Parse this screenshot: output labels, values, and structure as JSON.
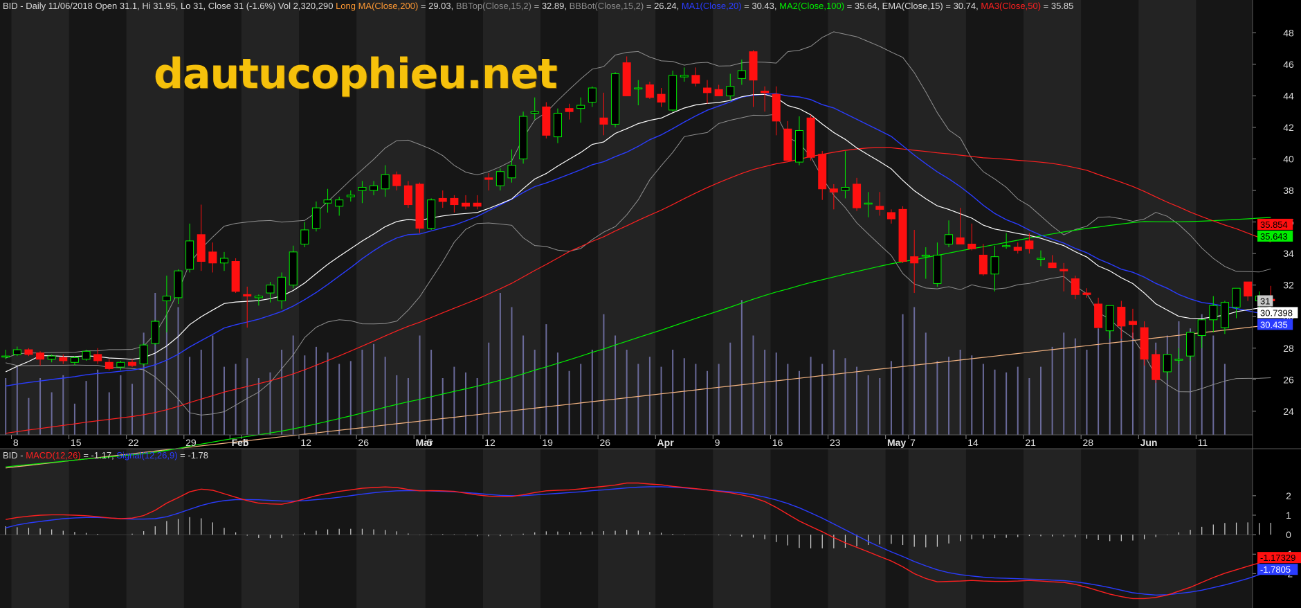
{
  "header_price": [
    {
      "text": "BID - Daily 11/06/2018 Open 31.1, Hi 31.95, Lo 31, Close 31 (-1.6%) Vol 2,320,290 ",
      "color": "#d8d8d8"
    },
    {
      "text": "Long MA(Close,200)",
      "color": "#ff9933"
    },
    {
      "text": " = 29.03, ",
      "color": "#d8d8d8"
    },
    {
      "text": "BBTop(Close,15,2)",
      "color": "#8c8c8c"
    },
    {
      "text": " = 32.89, ",
      "color": "#d8d8d8"
    },
    {
      "text": "BBBot(Close,15,2)",
      "color": "#8c8c8c"
    },
    {
      "text": " = 26.24, ",
      "color": "#d8d8d8"
    },
    {
      "text": "MA1(Close,20)",
      "color": "#2a3cff"
    },
    {
      "text": " = 30.43, ",
      "color": "#d8d8d8"
    },
    {
      "text": "MA2(Close,100)",
      "color": "#00ee00"
    },
    {
      "text": " = 35.64, EMA(Close,15) = 30.74, ",
      "color": "#d8d8d8"
    },
    {
      "text": "MA3(Close,50)",
      "color": "#ff2020"
    },
    {
      "text": " = 35.85",
      "color": "#d8d8d8"
    }
  ],
  "header_macd": [
    {
      "text": "BID - ",
      "color": "#d8d8d8"
    },
    {
      "text": "MACD(12,26)",
      "color": "#ff2020"
    },
    {
      "text": " = -1.17, ",
      "color": "#d8d8d8"
    },
    {
      "text": "Signal(12,26,9)",
      "color": "#2a3cff"
    },
    {
      "text": " = -1.78",
      "color": "#d8d8d8"
    }
  ],
  "watermark": "dautucophieu.net",
  "chart_data": [
    {
      "type": "candlestick",
      "ticker": "BID",
      "ylim": [
        22.5,
        49.2
      ],
      "yticks": [
        24,
        26,
        28,
        30,
        32,
        34,
        36,
        38,
        40,
        42,
        44,
        46,
        48
      ],
      "x_labels": [
        {
          "label": "8",
          "i": 1
        },
        {
          "label": "15",
          "i": 6
        },
        {
          "label": "22",
          "i": 11
        },
        {
          "label": "29",
          "i": 16
        },
        {
          "label": "Feb",
          "i": 20,
          "bold": true
        },
        {
          "label": "5",
          "i": 21
        },
        {
          "label": "12",
          "i": 26
        },
        {
          "label": "26",
          "i": 31
        },
        {
          "label": "Mar",
          "i": 36,
          "bold": true
        },
        {
          "label": "5",
          "i": 37
        },
        {
          "label": "12",
          "i": 42
        },
        {
          "label": "19",
          "i": 47
        },
        {
          "label": "26",
          "i": 52
        },
        {
          "label": "Apr",
          "i": 57,
          "bold": true
        },
        {
          "label": "9",
          "i": 62
        },
        {
          "label": "16",
          "i": 67
        },
        {
          "label": "23",
          "i": 72
        },
        {
          "label": "May",
          "i": 77,
          "bold": true
        },
        {
          "label": "7",
          "i": 79
        },
        {
          "label": "14",
          "i": 84
        },
        {
          "label": "21",
          "i": 89
        },
        {
          "label": "28",
          "i": 94
        },
        {
          "label": "Jun",
          "i": 99,
          "bold": true
        },
        {
          "label": "11",
          "i": 104
        }
      ],
      "candles": [
        [
          27.5,
          27.9,
          27.3,
          27.5
        ],
        [
          27.6,
          28.1,
          27.5,
          27.9
        ],
        [
          27.9,
          28.0,
          27.5,
          27.6
        ],
        [
          27.7,
          27.8,
          26.9,
          27.3
        ],
        [
          27.3,
          27.6,
          27.1,
          27.5
        ],
        [
          27.4,
          27.6,
          27.0,
          27.2
        ],
        [
          27.1,
          27.5,
          26.9,
          27.4
        ],
        [
          27.3,
          27.9,
          27.2,
          27.8
        ],
        [
          27.6,
          28.0,
          27.0,
          27.2
        ],
        [
          27.1,
          27.3,
          26.6,
          26.7
        ],
        [
          26.8,
          27.2,
          26.6,
          27.1
        ],
        [
          27.1,
          27.3,
          26.8,
          26.9
        ],
        [
          27.0,
          28.3,
          26.9,
          28.2
        ],
        [
          28.3,
          29.8,
          28.2,
          29.7
        ],
        [
          31.0,
          32.6,
          29.0,
          31.3
        ],
        [
          31.2,
          33.0,
          30.8,
          32.9
        ],
        [
          33.0,
          35.9,
          32.8,
          34.8
        ],
        [
          35.2,
          37.1,
          32.9,
          33.5
        ],
        [
          34.1,
          34.7,
          32.8,
          33.4
        ],
        [
          33.4,
          34.1,
          32.9,
          33.7
        ],
        [
          33.5,
          33.7,
          31.5,
          31.6
        ],
        [
          31.4,
          31.9,
          29.3,
          31.3
        ],
        [
          31.2,
          31.4,
          30.7,
          31.3
        ],
        [
          31.5,
          32.2,
          30.9,
          32.0
        ],
        [
          31.0,
          32.8,
          30.5,
          32.5
        ],
        [
          32.0,
          34.5,
          31.8,
          34.1
        ],
        [
          34.6,
          36.0,
          34.4,
          35.5
        ],
        [
          35.6,
          37.3,
          35.4,
          36.9
        ],
        [
          37.2,
          38.1,
          36.6,
          37.4
        ],
        [
          37.0,
          37.6,
          36.4,
          37.4
        ],
        [
          37.6,
          38.0,
          37.3,
          37.7
        ],
        [
          38.0,
          38.6,
          37.2,
          38.2
        ],
        [
          38.0,
          38.6,
          37.7,
          38.3
        ],
        [
          38.1,
          39.6,
          37.6,
          39.0
        ],
        [
          39.0,
          39.2,
          38.0,
          38.3
        ],
        [
          38.3,
          38.6,
          36.9,
          37.1
        ],
        [
          38.4,
          38.5,
          35.3,
          35.6
        ],
        [
          35.6,
          37.5,
          35.5,
          37.4
        ],
        [
          37.5,
          38.0,
          36.9,
          37.3
        ],
        [
          37.5,
          37.7,
          36.6,
          37.1
        ],
        [
          37.2,
          37.7,
          36.8,
          37.0
        ],
        [
          37.2,
          37.7,
          36.8,
          37.0
        ],
        [
          38.8,
          39.1,
          38.0,
          38.7
        ],
        [
          38.3,
          39.4,
          38.0,
          39.2
        ],
        [
          38.8,
          40.6,
          38.5,
          39.6
        ],
        [
          40.0,
          43.0,
          39.7,
          42.7
        ],
        [
          42.9,
          43.9,
          42.5,
          43.0
        ],
        [
          43.3,
          43.6,
          41.3,
          41.5
        ],
        [
          41.4,
          43.2,
          41.0,
          42.9
        ],
        [
          43.2,
          43.5,
          42.5,
          43.0
        ],
        [
          43.2,
          43.9,
          42.3,
          43.4
        ],
        [
          43.6,
          44.6,
          43.3,
          44.5
        ],
        [
          42.6,
          44.2,
          41.5,
          42.2
        ],
        [
          42.2,
          45.5,
          42.0,
          45.4
        ],
        [
          46.1,
          46.5,
          44.0,
          44.0
        ],
        [
          44.5,
          45.0,
          43.4,
          44.5
        ],
        [
          44.7,
          44.9,
          43.8,
          43.9
        ],
        [
          44.1,
          44.5,
          43.3,
          43.6
        ],
        [
          43.1,
          45.6,
          43.0,
          45.3
        ],
        [
          45.2,
          45.8,
          44.9,
          45.3
        ],
        [
          45.3,
          45.8,
          44.6,
          44.8
        ],
        [
          44.5,
          45.0,
          43.5,
          44.2
        ],
        [
          44.4,
          44.7,
          44.0,
          44.0
        ],
        [
          44.0,
          45.4,
          43.7,
          44.6
        ],
        [
          45.1,
          46.3,
          44.7,
          45.6
        ],
        [
          46.8,
          46.9,
          43.3,
          45.0
        ],
        [
          44.3,
          44.6,
          43.0,
          44.2
        ],
        [
          44.1,
          44.6,
          41.5,
          42.4
        ],
        [
          41.9,
          42.4,
          40.0,
          39.9
        ],
        [
          39.8,
          42.7,
          39.6,
          41.8
        ],
        [
          42.6,
          42.8,
          39.9,
          40.1
        ],
        [
          40.3,
          40.5,
          37.4,
          38.1
        ],
        [
          38.1,
          38.4,
          36.8,
          37.9
        ],
        [
          38.0,
          40.5,
          37.5,
          38.2
        ],
        [
          38.4,
          38.8,
          36.7,
          36.9
        ],
        [
          37.2,
          37.9,
          36.3,
          37.2
        ],
        [
          37.0,
          37.9,
          36.4,
          36.8
        ],
        [
          36.6,
          36.8,
          35.9,
          36.2
        ],
        [
          36.8,
          37.0,
          33.4,
          33.5
        ],
        [
          33.8,
          35.5,
          31.5,
          33.4
        ],
        [
          33.9,
          34.4,
          32.4,
          33.9
        ],
        [
          32.1,
          34.7,
          31.9,
          33.9
        ],
        [
          34.6,
          36.1,
          34.4,
          35.2
        ],
        [
          35.0,
          36.9,
          34.8,
          34.6
        ],
        [
          34.6,
          35.9,
          34.2,
          34.3
        ],
        [
          33.9,
          34.6,
          32.6,
          32.7
        ],
        [
          32.7,
          34.5,
          31.6,
          33.8
        ],
        [
          34.5,
          35.3,
          34.3,
          34.5
        ],
        [
          34.4,
          34.7,
          34.0,
          34.2
        ],
        [
          34.8,
          35.3,
          34.0,
          34.3
        ],
        [
          33.7,
          34.2,
          33.2,
          33.7
        ],
        [
          33.4,
          33.9,
          33.2,
          33.1
        ],
        [
          33.0,
          33.4,
          31.6,
          32.9
        ],
        [
          32.4,
          32.6,
          31.1,
          31.4
        ],
        [
          31.5,
          31.8,
          31.2,
          31.4
        ],
        [
          30.8,
          31.2,
          29.3,
          29.3
        ],
        [
          29.1,
          30.5,
          28.6,
          30.7
        ],
        [
          30.6,
          31.0,
          28.6,
          29.4
        ],
        [
          29.7,
          30.5,
          28.6,
          29.5
        ],
        [
          29.3,
          29.7,
          26.9,
          27.3
        ],
        [
          27.6,
          27.9,
          25.8,
          26.0
        ],
        [
          26.5,
          27.6,
          26.0,
          27.6
        ],
        [
          27.3,
          28.0,
          27.0,
          27.3
        ],
        [
          27.5,
          29.0,
          27.2,
          29.0
        ],
        [
          28.8,
          29.6,
          28.0,
          29.8
        ],
        [
          29.8,
          31.3,
          29.0,
          30.7
        ],
        [
          29.3,
          31.0,
          28.9,
          30.9
        ],
        [
          30.6,
          31.7,
          29.9,
          31.8
        ],
        [
          32.2,
          32.2,
          31.0,
          31.3
        ],
        [
          31.0,
          31.6,
          30.5,
          31.3
        ],
        [
          31.1,
          31.95,
          31.0,
          31.0
        ]
      ],
      "volume": [
        40,
        48,
        26,
        40,
        30,
        42,
        22,
        38,
        46,
        30,
        42,
        36,
        72,
        100,
        85,
        90,
        55,
        60,
        70,
        48,
        50,
        54,
        40,
        44,
        60,
        70,
        56,
        62,
        58,
        50,
        52,
        60,
        64,
        55,
        42,
        40,
        70,
        60,
        40,
        48,
        44,
        40,
        65,
        100,
        90,
        70,
        60,
        78,
        58,
        45,
        50,
        60,
        85,
        70,
        60,
        50,
        55,
        48,
        60,
        54,
        50,
        45,
        50,
        65,
        95,
        70,
        60,
        58,
        50,
        45,
        55,
        50,
        60,
        54,
        48,
        42,
        40,
        52,
        85,
        90,
        72,
        52,
        55,
        60,
        56,
        50,
        46,
        44,
        48,
        40,
        48,
        62,
        72,
        68,
        60,
        75,
        90,
        85,
        72,
        60,
        65,
        70,
        80,
        75,
        85,
        70,
        50
      ],
      "volume_axis_max": 160,
      "macd": [
        0.78,
        0.88,
        0.95,
        1.0,
        1.02,
        1.02,
        1.0,
        0.97,
        0.92,
        0.86,
        0.82,
        0.85,
        0.98,
        1.25,
        1.62,
        1.9,
        2.2,
        2.34,
        2.28,
        2.1,
        1.92,
        1.75,
        1.62,
        1.58,
        1.56,
        1.68,
        1.84,
        2.0,
        2.12,
        2.22,
        2.3,
        2.38,
        2.42,
        2.45,
        2.42,
        2.32,
        2.25,
        2.26,
        2.25,
        2.22,
        2.13,
        2.04,
        1.98,
        1.95,
        1.96,
        2.05,
        2.16,
        2.25,
        2.28,
        2.3,
        2.35,
        2.42,
        2.48,
        2.55,
        2.65,
        2.65,
        2.6,
        2.56,
        2.48,
        2.42,
        2.36,
        2.3,
        2.22,
        2.15,
        2.04,
        1.9,
        1.7,
        1.4,
        1.05,
        0.7,
        0.42,
        0.15,
        -0.15,
        -0.42,
        -0.65,
        -0.88,
        -1.12,
        -1.35,
        -1.65,
        -2.0,
        -2.25,
        -2.42,
        -2.4,
        -2.38,
        -2.35,
        -2.38,
        -2.4,
        -2.4,
        -2.38,
        -2.35,
        -2.38,
        -2.42,
        -2.45,
        -2.55,
        -2.7,
        -2.88,
        -3.05,
        -3.18,
        -3.28,
        -3.28,
        -3.22,
        -3.1,
        -2.9,
        -2.7,
        -2.45,
        -2.2,
        -1.98,
        -1.8,
        -1.62,
        -1.45,
        -1.17
      ],
      "signal": [
        0.35,
        0.5,
        0.6,
        0.68,
        0.75,
        0.82,
        0.86,
        0.88,
        0.88,
        0.86,
        0.82,
        0.8,
        0.8,
        0.82,
        0.92,
        1.1,
        1.3,
        1.5,
        1.65,
        1.75,
        1.8,
        1.8,
        1.79,
        1.76,
        1.73,
        1.72,
        1.75,
        1.8,
        1.85,
        1.92,
        2.0,
        2.08,
        2.15,
        2.21,
        2.25,
        2.26,
        2.26,
        2.24,
        2.22,
        2.2,
        2.16,
        2.12,
        2.06,
        2.02,
        2.0,
        2.0,
        2.04,
        2.08,
        2.12,
        2.16,
        2.2,
        2.26,
        2.3,
        2.35,
        2.4,
        2.44,
        2.46,
        2.46,
        2.44,
        2.4,
        2.35,
        2.3,
        2.25,
        2.2,
        2.14,
        2.05,
        1.93,
        1.78,
        1.6,
        1.38,
        1.12,
        0.85,
        0.55,
        0.25,
        -0.05,
        -0.35,
        -0.62,
        -0.88,
        -1.12,
        -1.38,
        -1.6,
        -1.8,
        -1.95,
        -2.05,
        -2.12,
        -2.18,
        -2.22,
        -2.24,
        -2.26,
        -2.28,
        -2.3,
        -2.33,
        -2.36,
        -2.42,
        -2.5,
        -2.6,
        -2.72,
        -2.85,
        -2.98,
        -3.05,
        -3.1,
        -3.08,
        -3.02,
        -2.95,
        -2.85,
        -2.72,
        -2.58,
        -2.42,
        -2.25,
        -2.05,
        -1.78
      ],
      "macd_ylim": [
        -3.55,
        3.7
      ],
      "macd_yticks": [
        2,
        1,
        0,
        -1,
        -2
      ],
      "colors": {
        "up_fill": "#000000",
        "up_border": "#00ee00",
        "down": "#ff1010",
        "wick_up": "#00ee00",
        "wick_down": "#ff1010",
        "ma20": "#2a3cff",
        "ma50": "#ff2020",
        "ma100": "#00ee00",
        "ma200": "#f4b482",
        "ema15": "#ffffff",
        "bb": "#909090",
        "macd": "#ff2020",
        "signal": "#2a3cff",
        "hist": "#d0d0d0",
        "volume": "#6a6a9a"
      },
      "badges": [
        {
          "text": "35.854",
          "value": 35.854,
          "bg": "#ff1010",
          "fg": "#000000"
        },
        {
          "text": "35.643",
          "value": 35.643,
          "bg": "#00ee00",
          "fg": "#000000"
        },
        {
          "text": "31",
          "value": 31.0,
          "bg": "#c8c8c8",
          "fg": "#000000"
        },
        {
          "text": "30.7398",
          "value": 30.7398,
          "bg": "#ffffff",
          "fg": "#000000"
        },
        {
          "text": "30.435",
          "value": 30.435,
          "bg": "#2a3cff",
          "fg": "#ffffff"
        }
      ],
      "macd_badges": [
        {
          "text": "-1.17329",
          "value": -1.17329,
          "bg": "#ff1010",
          "fg": "#000000"
        },
        {
          "text": "-1.7805",
          "value": -1.7805,
          "bg": "#2a3cff",
          "fg": "#ffffff"
        }
      ]
    }
  ]
}
